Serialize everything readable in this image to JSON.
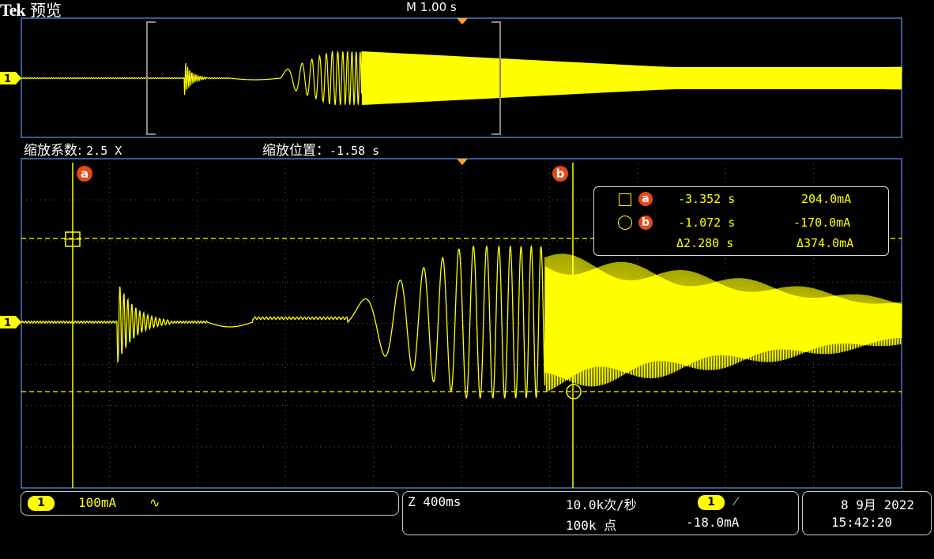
{
  "header": {
    "brand": "Tek",
    "mode": "预览",
    "timebase": "M 1.00 s"
  },
  "zoom": {
    "factor_label": "缩放系数: ",
    "factor_value": "2.5 X",
    "position_label": "缩放位置：",
    "position_value": "-1.58 s"
  },
  "channel_marker": "1",
  "cursor_labels": {
    "a": "a",
    "b": "b"
  },
  "readout": {
    "row_a": {
      "time": "-3.352 s",
      "value": "204.0mA"
    },
    "row_b": {
      "time": "-1.072 s",
      "value": "-170.0mA"
    },
    "row_delta": {
      "time": "Δ2.280 s",
      "value": "Δ374.0mA"
    }
  },
  "status": {
    "channel": "1",
    "scale": "100mA",
    "coupling_symbol": "∿",
    "zoom": "Z 400ms",
    "sample_rate": "10.0k次/秒",
    "record_length": "100k 点",
    "trigger_channel": "1",
    "trigger_slope": "⁄",
    "trigger_level": "-18.0mA",
    "date": "8 9月 2022",
    "time": "15:42:20"
  },
  "colors": {
    "trace": "#ffff00",
    "cursor_badge": "#e8461b",
    "grid_frame": "#4a78c0",
    "tb_marker": "#f5a623"
  }
}
